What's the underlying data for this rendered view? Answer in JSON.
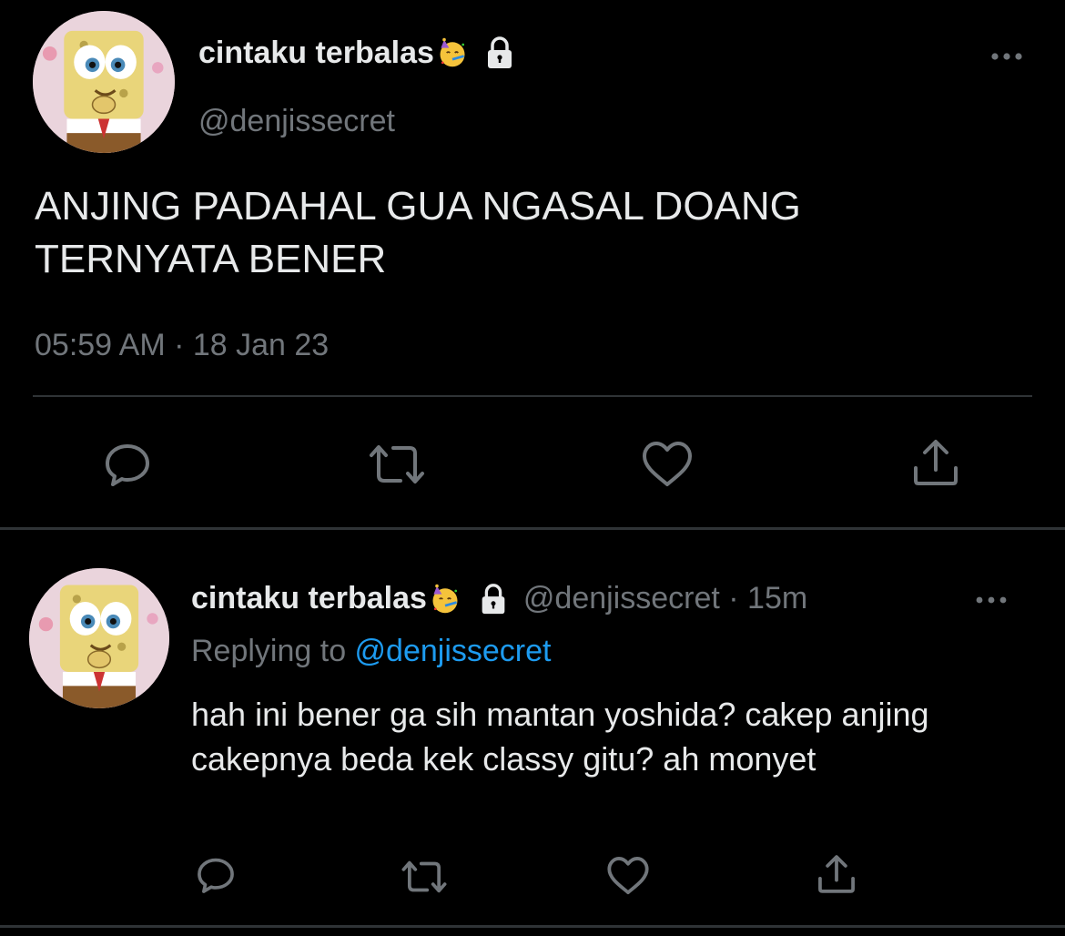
{
  "main_tweet": {
    "display_name": "cintaku terbalas",
    "handle": "@denjissecret",
    "text_line1": "ANJING PADAHAL GUA NGASAL DOANG",
    "text_line2": "TERNYATA BENER",
    "timestamp": "05:59 AM · 18 Jan 23"
  },
  "reply_tweet": {
    "display_name": "cintaku terbalas",
    "meta": "@denjissecret · 15m",
    "replying_prefix": "Replying to ",
    "replying_handle": "@denjissecret",
    "text": "hah ini bener ga sih mantan yoshida? cakep anjing cakepnya beda kek classy gitu? ah monyet"
  },
  "icons": {
    "avatar": "spongebob-avatar",
    "emoji": "partying-face-emoji",
    "protected": "lock-icon",
    "more": "more-dots-icon",
    "reply": "reply-bubble-icon",
    "retweet": "retweet-icon",
    "like": "heart-icon",
    "share": "share-icon"
  },
  "colors": {
    "background": "#000000",
    "text_primary": "#e7e9ea",
    "text_secondary": "#71767b",
    "link": "#1d9bf0",
    "divider": "#2f3336"
  }
}
